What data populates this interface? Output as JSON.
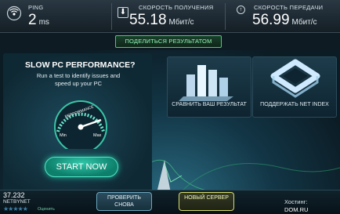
{
  "top": {
    "ping": {
      "label": "PING",
      "value": "2",
      "unit": "ms",
      "icon": "signal-icon"
    },
    "download": {
      "label": "СКОРОСТЬ ПОЛУЧЕНИЯ",
      "value": "55.18",
      "unit": "Мбит/с",
      "icon": "download-arrow-icon"
    },
    "upload": {
      "label": "СКОРОСТЬ ПЕРЕДАЧИ",
      "value": "56.99",
      "unit": "Мбит/с",
      "icon": "upload-arrow-icon"
    }
  },
  "share_label": "ПОДЕЛИТЬСЯ РЕЗУЛЬТАТОМ",
  "promo": {
    "title": "SLOW PC PERFORMANCE?",
    "subtitle": "Run a test to identify issues and speed up your PC",
    "gauge": {
      "label": "PERFORMANCE",
      "min": "Min",
      "max": "Max"
    },
    "cta": "START NOW"
  },
  "cards": [
    {
      "label": "СРАВНИТЬ ВАШ РЕЗУЛЬТАТ",
      "icon": "bar-chart-icon"
    },
    {
      "label": "ПОДДЕРЖАТЬ NET INDEX",
      "icon": "net-index-icon"
    }
  ],
  "footer": {
    "ip": "37.232",
    "isp": "NETBYNET",
    "rating_text": "Оценить",
    "retry": "ПРОВЕРИТЬ СНОВА",
    "new_server": "НОВЫЙ СЕРВЕР",
    "host_label": "Хостинг:",
    "host_value": "DOM.RU"
  },
  "colors": {
    "accent_green": "#37d66e",
    "teal": "#1fb99a",
    "bg": "#0b1a22"
  }
}
